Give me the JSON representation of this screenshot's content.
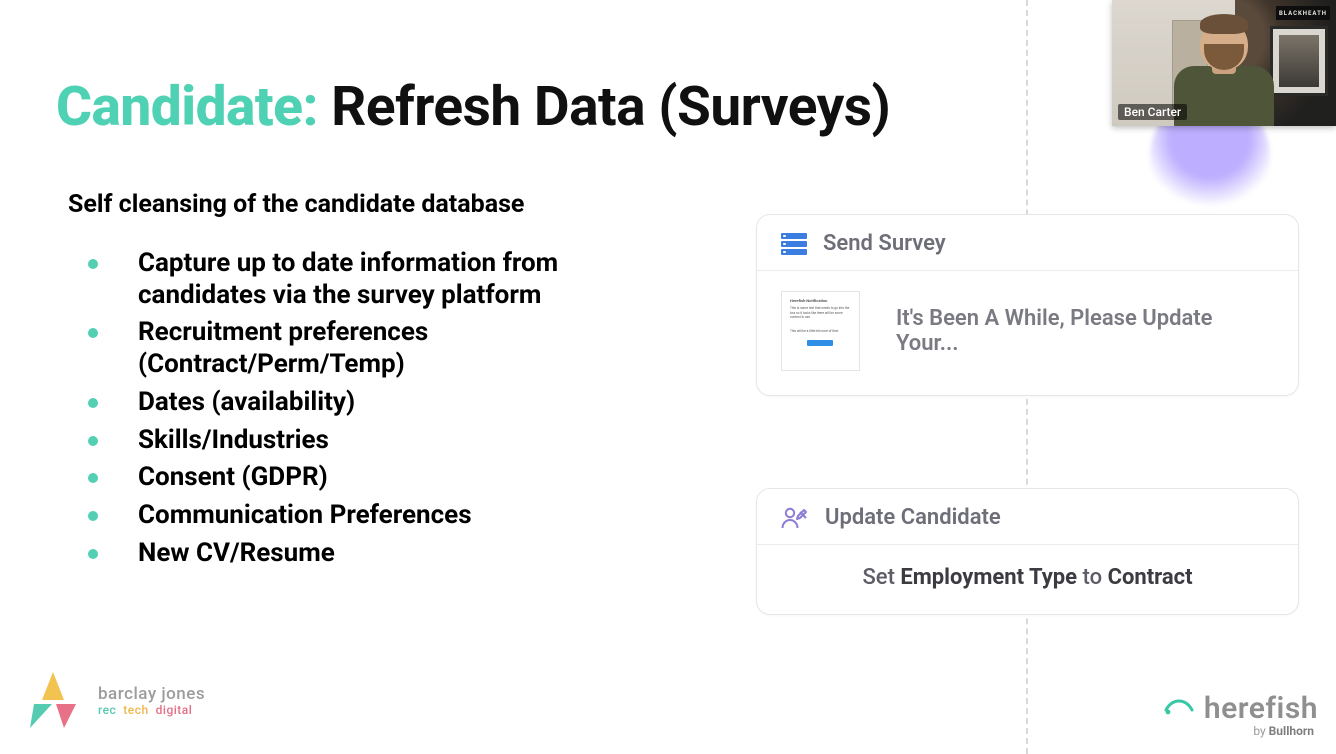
{
  "title": {
    "accent": "Candidate:",
    "main": " Refresh Data (Surveys)"
  },
  "subtitle": "Self cleansing of the candidate database",
  "bullets": [
    "Capture up to date information from candidates via the survey platform",
    "Recruitment preferences (Contract/Perm/Temp)",
    "Dates (availability)",
    "Skills/Industries",
    "Consent (GDPR)",
    "Communication Preferences",
    "New CV/Resume"
  ],
  "card_survey": {
    "heading": "Send Survey",
    "body": "It's Been A While, Please Update Your...",
    "thumb": {
      "title": "Herefish Notification",
      "line1": "This is some text that needs to go into the box so it looks like there will be some content in use.",
      "line2": "This will be a little bit more of that."
    }
  },
  "card_update": {
    "heading": "Update Candidate",
    "body_pre": "Set ",
    "body_field": "Employment Type",
    "body_mid": " to ",
    "body_value": "Contract"
  },
  "logo_bj": {
    "line1": "barclay jones",
    "parts": {
      "a": "rec",
      "b": "tech",
      "c": "digital"
    }
  },
  "logo_hf": {
    "word": "herefish",
    "by": "by ",
    "brand": "Bullhorn"
  },
  "video": {
    "name": "Ben Carter",
    "sign": "BLACKHEATH"
  }
}
